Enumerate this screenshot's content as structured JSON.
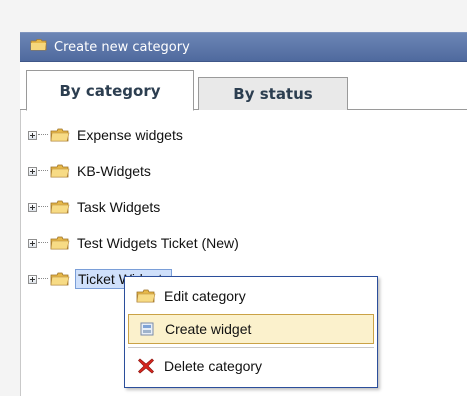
{
  "header": {
    "title": "Create new category",
    "icon": "folder-icon"
  },
  "tabs": [
    {
      "label": "By category",
      "active": true
    },
    {
      "label": "By status",
      "active": false
    }
  ],
  "tree": {
    "items": [
      {
        "label": "Expense widgets"
      },
      {
        "label": "KB-Widgets"
      },
      {
        "label": "Task Widgets"
      },
      {
        "label": "Test Widgets Ticket (New)"
      },
      {
        "label": "Ticket Widgets",
        "selected": true
      }
    ]
  },
  "context_menu": {
    "items": [
      {
        "label": "Edit category",
        "icon": "folder-icon"
      },
      {
        "label": "Create widget",
        "icon": "widget-icon",
        "hovered": true
      },
      {
        "label": "Delete category",
        "icon": "delete-icon"
      }
    ]
  },
  "colors": {
    "header_bg": "#5a76aa",
    "menu_border": "#2b4e9b",
    "hover_bg": "#fbf1cc",
    "selected_bg": "#cfe0fb"
  }
}
